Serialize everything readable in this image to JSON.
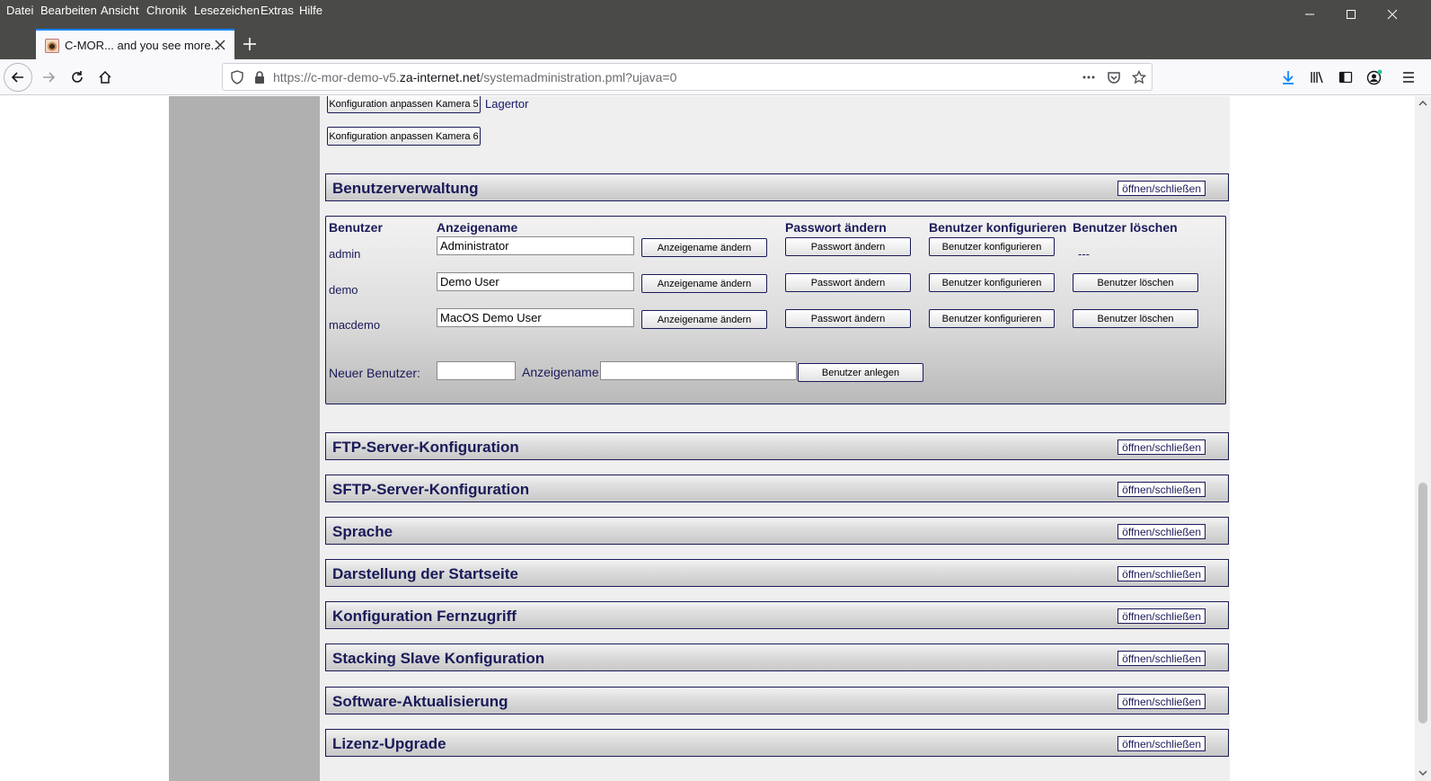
{
  "browser": {
    "menu": [
      "Datei",
      "Bearbeiten",
      "Ansicht",
      "Chronik",
      "Lesezeichen",
      "Extras",
      "Hilfe"
    ],
    "tab_title": "C-MOR... and you see more...",
    "url_prefix": "https://c-mor-demo-v5.",
    "url_domain": "za-internet.net",
    "url_suffix": "/systemadministration.pml?ujava=0"
  },
  "cameras": {
    "cam5_button": "Konfiguration anpassen Kamera 5",
    "cam5_label": "Lagertor",
    "cam6_button": "Konfiguration anpassen Kamera 6"
  },
  "toggle_label": "öffnen/schließen",
  "user_management": {
    "title": "Benutzerverwaltung",
    "headers": {
      "user": "Benutzer",
      "display_name": "Anzeigename",
      "password": "Passwort ändern",
      "configure": "Benutzer konfigurieren",
      "delete": "Benutzer löschen"
    },
    "users": [
      {
        "name": "admin",
        "display_name": "Administrator",
        "delete": "---"
      },
      {
        "name": "demo",
        "display_name": "Demo User",
        "delete": "Benutzer löschen"
      },
      {
        "name": "macdemo",
        "display_name": "MacOS Demo User",
        "delete": "Benutzer löschen"
      }
    ],
    "buttons": {
      "change_display_name": "Anzeigename ändern",
      "change_password": "Passwort ändern",
      "configure_user": "Benutzer konfigurieren",
      "delete_user": "Benutzer löschen"
    },
    "new_user_label": "Neuer Benutzer:",
    "new_display_name_label": "Anzeigename:",
    "new_user_value": "",
    "new_display_name_value": "",
    "create_button": "Benutzer anlegen"
  },
  "sections": [
    "FTP-Server-Konfiguration",
    "SFTP-Server-Konfiguration",
    "Sprache",
    "Darstellung der Startseite",
    "Konfiguration Fernzugriff",
    "Stacking Slave Konfiguration",
    "Software-Aktualisierung",
    "Lizenz-Upgrade"
  ]
}
